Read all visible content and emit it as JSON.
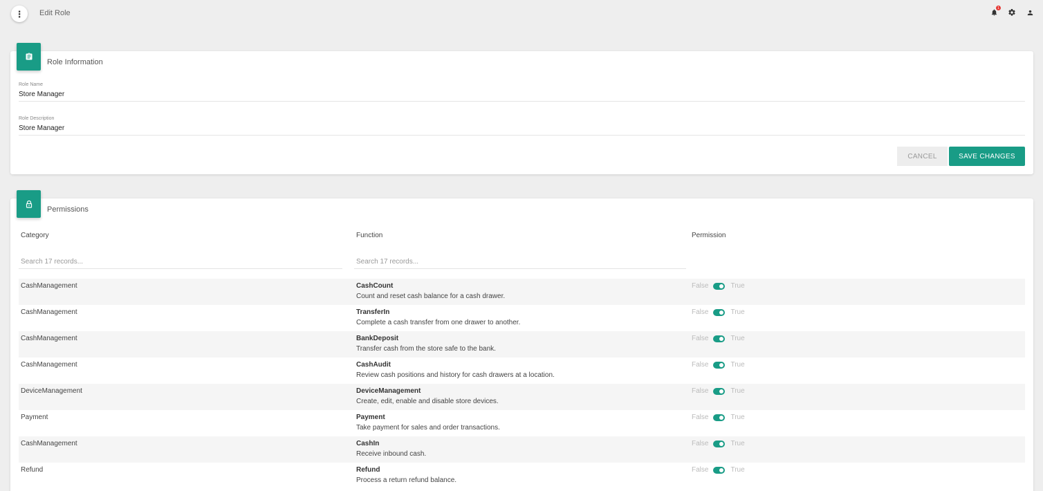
{
  "header": {
    "menu_glyph": "⋮",
    "title": "Edit Role",
    "notification_count": "1"
  },
  "role_info": {
    "title": "Role Information",
    "name_label": "Role Name",
    "name_value": "Store Manager",
    "description_label": "Role Description",
    "description_value": "Store Manager",
    "cancel_label": "CANCEL",
    "save_label": "SAVE CHANGES"
  },
  "permissions": {
    "title": "Permissions",
    "columns": {
      "category": "Category",
      "function": "Function",
      "permission": "Permission"
    },
    "category_search_placeholder": "Search 17 records...",
    "function_search_placeholder": "Search 17 records...",
    "false_label": "False",
    "true_label": "True",
    "rows": [
      {
        "category": "CashManagement",
        "function": "CashCount",
        "description": "Count and reset cash balance for a cash drawer.",
        "permission": true
      },
      {
        "category": "CashManagement",
        "function": "TransferIn",
        "description": "Complete a cash transfer from one drawer to another.",
        "permission": true
      },
      {
        "category": "CashManagement",
        "function": "BankDeposit",
        "description": "Transfer cash from the store safe to the bank.",
        "permission": true
      },
      {
        "category": "CashManagement",
        "function": "CashAudit",
        "description": "Review cash positions and history for cash drawers at a location.",
        "permission": true
      },
      {
        "category": "DeviceManagement",
        "function": "DeviceManagement",
        "description": "Create, edit, enable and disable store devices.",
        "permission": true
      },
      {
        "category": "Payment",
        "function": "Payment",
        "description": "Take payment for sales and order transactions.",
        "permission": true
      },
      {
        "category": "CashManagement",
        "function": "CashIn",
        "description": "Receive inbound cash.",
        "permission": true
      },
      {
        "category": "Refund",
        "function": "Refund",
        "description": "Process a return refund balance.",
        "permission": true
      }
    ]
  },
  "colors": {
    "accent": "#199c86",
    "background": "#eeeeee"
  }
}
